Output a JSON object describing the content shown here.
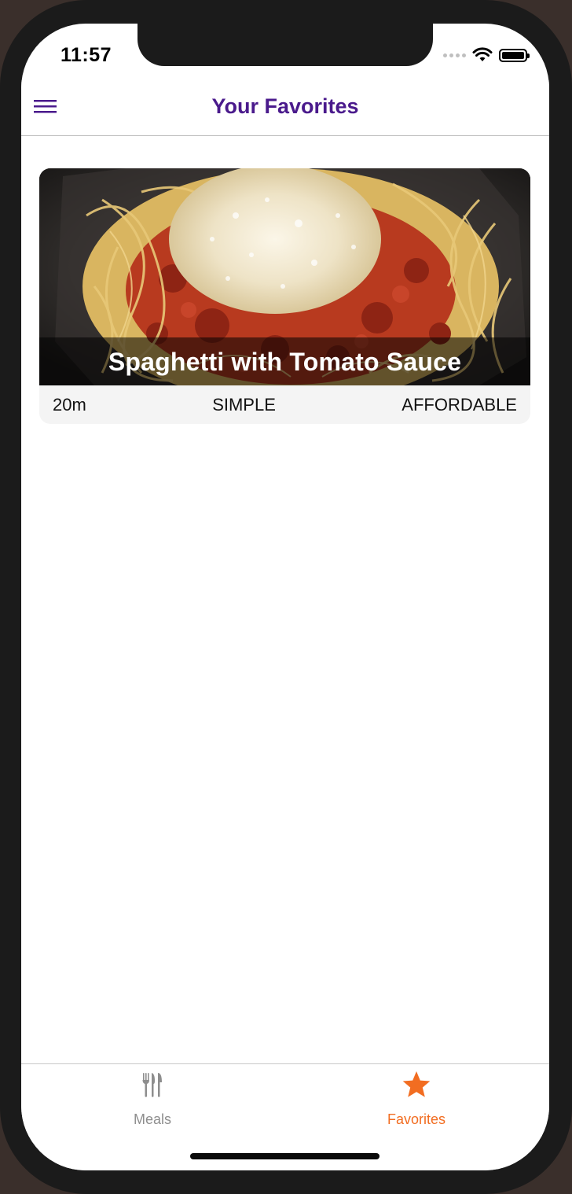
{
  "status_bar": {
    "time": "11:57"
  },
  "header": {
    "title": "Your Favorites",
    "menu_icon": "hamburger-menu-icon"
  },
  "favorites": [
    {
      "title": "Spaghetti with Tomato Sauce",
      "duration": "20m",
      "complexity": "SIMPLE",
      "affordability": "AFFORDABLE"
    }
  ],
  "tabs": [
    {
      "label": "Meals",
      "icon": "cutlery-icon",
      "active": false
    },
    {
      "label": "Favorites",
      "icon": "star-icon",
      "active": true
    }
  ],
  "colors": {
    "primary": "#4a1a8c",
    "accent": "#f26d21",
    "inactive": "#8e8e8e"
  }
}
